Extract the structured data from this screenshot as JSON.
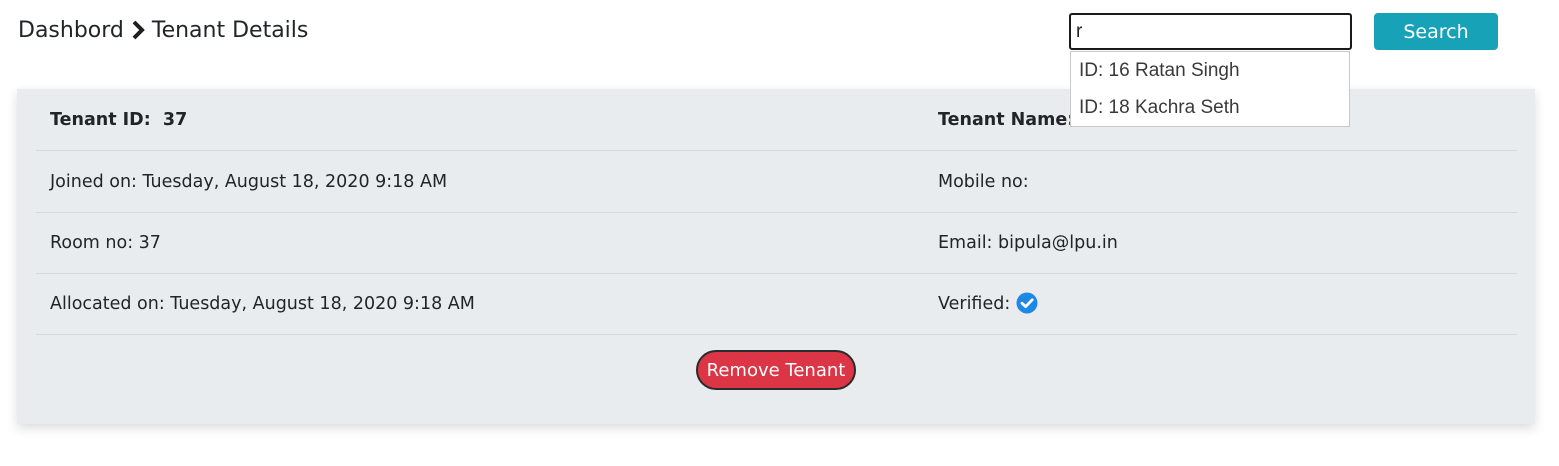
{
  "breadcrumb": {
    "home": "Dashbord",
    "current": "Tenant Details"
  },
  "search": {
    "value": "r",
    "button_label": "Search",
    "suggestions": [
      "ID: 16 Ratan Singh",
      "ID: 18 Kachra Seth"
    ]
  },
  "tenant": {
    "id_label": "Tenant ID:",
    "id_value": "37",
    "name_label": "Tenant Name:",
    "joined": "Joined on: Tuesday, August 18, 2020 9:18 AM",
    "mobile": "Mobile no:",
    "room": "Room no: 37",
    "email": "Email: bipula@lpu.in",
    "allocated": "Allocated on: Tuesday, August 18, 2020 9:18 AM",
    "verified_label": "Verified:",
    "verified": true
  },
  "actions": {
    "remove_label": "Remove Tenant"
  },
  "colors": {
    "search_button": "#17a2b8",
    "remove_button": "#dc3545",
    "verified_icon": "#1e88e5",
    "card_background": "#e9ecef"
  },
  "icons": {
    "breadcrumb_separator": "chevron-right-icon",
    "verified": "check-circle-icon"
  }
}
